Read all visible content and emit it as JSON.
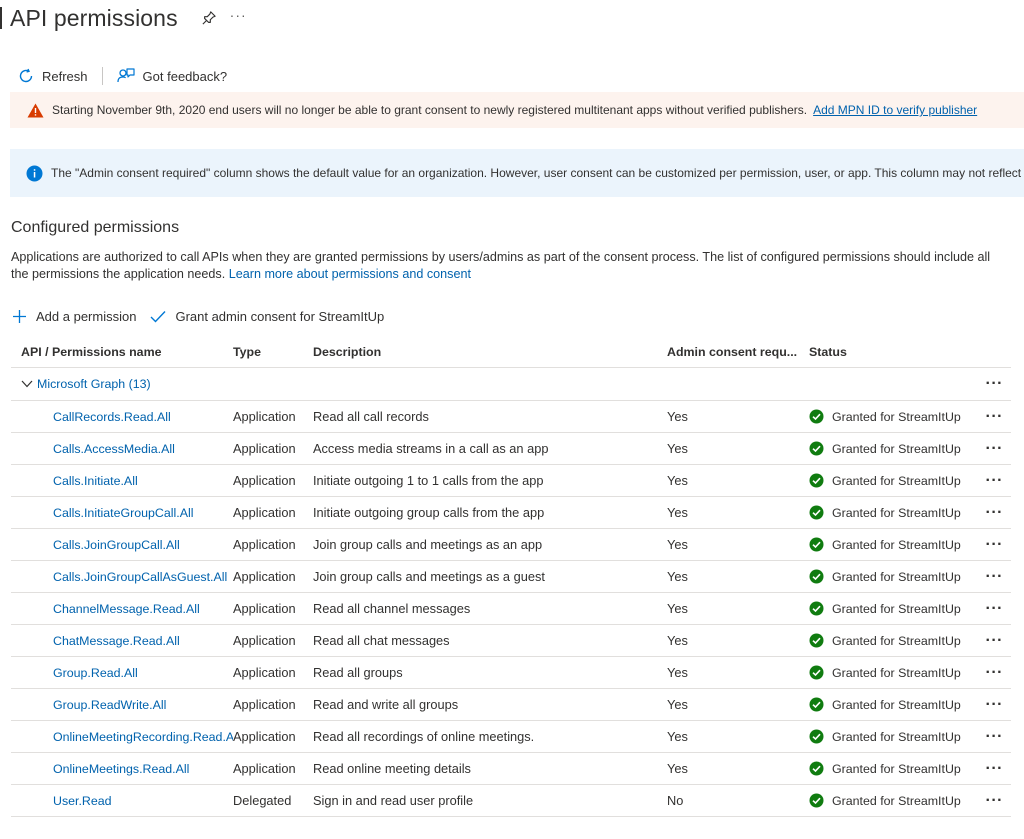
{
  "header": {
    "title": "API permissions"
  },
  "toolbar": {
    "refresh_label": "Refresh",
    "feedback_label": "Got feedback?"
  },
  "warning_banner": {
    "text": "Starting November 9th, 2020 end users will no longer be able to grant consent to newly registered multitenant apps without verified publishers.",
    "link": "Add MPN ID to verify publisher"
  },
  "info_banner": {
    "text": "The \"Admin consent required\" column shows the default value for an organization. However, user consent can be customized per permission, user, or app. This column may not reflect t"
  },
  "section": {
    "title": "Configured permissions",
    "description": "Applications are authorized to call APIs when they are granted permissions by users/admins as part of the consent process. The list of configured permissions should include all the permissions the application needs.",
    "learn_more": "Learn more about permissions and consent"
  },
  "actions": {
    "add_label": "Add a permission",
    "grant_label": "Grant admin consent for StreamItUp"
  },
  "table": {
    "columns": {
      "name": "API / Permissions name",
      "type": "Type",
      "description": "Description",
      "admin": "Admin consent requ...",
      "status": "Status"
    },
    "group": {
      "label": "Microsoft Graph (13)"
    },
    "rows": [
      {
        "name": "CallRecords.Read.All",
        "type": "Application",
        "description": "Read all call records",
        "admin": "Yes",
        "status": "Granted for StreamItUp"
      },
      {
        "name": "Calls.AccessMedia.All",
        "type": "Application",
        "description": "Access media streams in a call as an app",
        "admin": "Yes",
        "status": "Granted for StreamItUp"
      },
      {
        "name": "Calls.Initiate.All",
        "type": "Application",
        "description": "Initiate outgoing 1 to 1 calls from the app",
        "admin": "Yes",
        "status": "Granted for StreamItUp"
      },
      {
        "name": "Calls.InitiateGroupCall.All",
        "type": "Application",
        "description": "Initiate outgoing group calls from the app",
        "admin": "Yes",
        "status": "Granted for StreamItUp"
      },
      {
        "name": "Calls.JoinGroupCall.All",
        "type": "Application",
        "description": "Join group calls and meetings as an app",
        "admin": "Yes",
        "status": "Granted for StreamItUp"
      },
      {
        "name": "Calls.JoinGroupCallAsGuest.All",
        "type": "Application",
        "description": "Join group calls and meetings as a guest",
        "admin": "Yes",
        "status": "Granted for StreamItUp"
      },
      {
        "name": "ChannelMessage.Read.All",
        "type": "Application",
        "description": "Read all channel messages",
        "admin": "Yes",
        "status": "Granted for StreamItUp"
      },
      {
        "name": "ChatMessage.Read.All",
        "type": "Application",
        "description": "Read all chat messages",
        "admin": "Yes",
        "status": "Granted for StreamItUp"
      },
      {
        "name": "Group.Read.All",
        "type": "Application",
        "description": "Read all groups",
        "admin": "Yes",
        "status": "Granted for StreamItUp"
      },
      {
        "name": "Group.ReadWrite.All",
        "type": "Application",
        "description": "Read and write all groups",
        "admin": "Yes",
        "status": "Granted for StreamItUp"
      },
      {
        "name": "OnlineMeetingRecording.Read.A",
        "type": "Application",
        "description": "Read all recordings of online meetings.",
        "admin": "Yes",
        "status": "Granted for StreamItUp"
      },
      {
        "name": "OnlineMeetings.Read.All",
        "type": "Application",
        "description": "Read online meeting details",
        "admin": "Yes",
        "status": "Granted for StreamItUp"
      },
      {
        "name": "User.Read",
        "type": "Delegated",
        "description": "Sign in and read user profile",
        "admin": "No",
        "status": "Granted for StreamItUp"
      }
    ]
  },
  "colors": {
    "link": "#0062ad",
    "granted": "#107c10",
    "warning": "#d83b01",
    "info": "#0078d4"
  },
  "icons": {
    "pin": "pin-icon",
    "more": "more-icon",
    "refresh": "refresh-icon",
    "feedback": "feedback-icon",
    "warning": "warning-icon",
    "info": "info-icon",
    "add": "add-icon",
    "check": "check-icon",
    "chevron": "chevron-down-icon",
    "granted": "granted-check-icon"
  }
}
